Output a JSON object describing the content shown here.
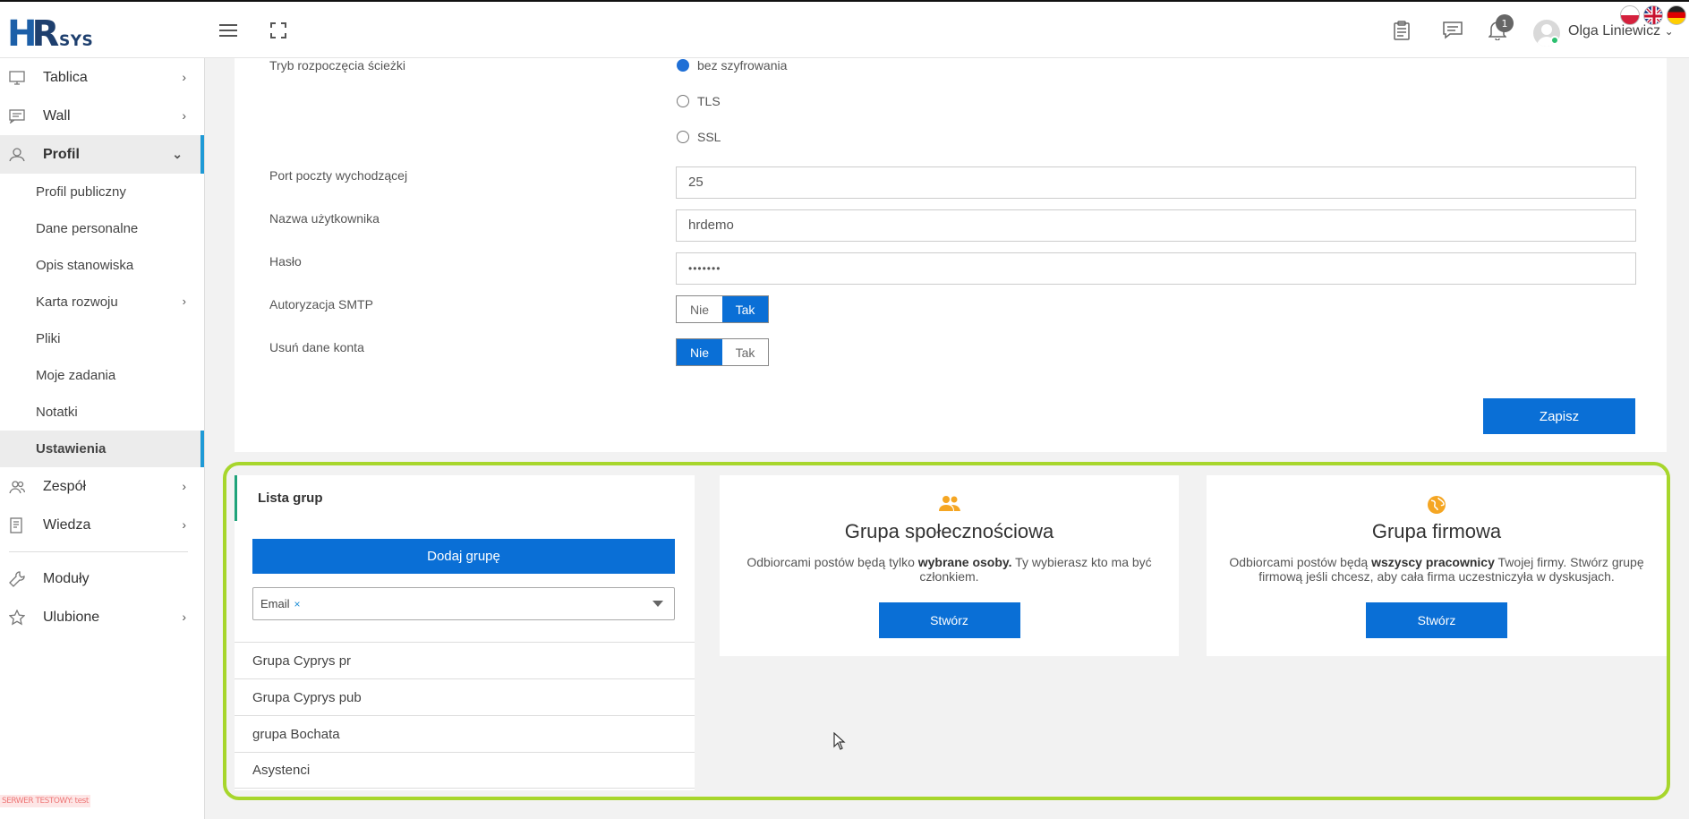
{
  "brand": {
    "logo_text_h": "H",
    "logo_text_r": "R",
    "logo_sys": "SYS"
  },
  "topbar": {
    "notification_count": "1",
    "user_name": "Olga Liniewicz",
    "user_chevron": "⌄",
    "icons": [
      "menu-icon",
      "fullscreen-icon",
      "clipboard-icon",
      "chat-icon",
      "bell-icon"
    ],
    "languages": [
      "pl-flag",
      "en-flag",
      "de-flag"
    ]
  },
  "sidebar": {
    "items": [
      {
        "label": "Tablica",
        "icon": "dashboard-icon",
        "chevron": "›"
      },
      {
        "label": "Wall",
        "icon": "wall-icon",
        "chevron": "›"
      },
      {
        "label": "Profil",
        "icon": "user-icon",
        "chevron": "⌄"
      }
    ],
    "profile_sub": [
      {
        "label": "Profil publiczny"
      },
      {
        "label": "Dane personalne"
      },
      {
        "label": "Opis stanowiska"
      },
      {
        "label": "Karta rozwoju",
        "chevron": "›"
      },
      {
        "label": "Pliki"
      },
      {
        "label": "Moje zadania"
      },
      {
        "label": "Notatki"
      },
      {
        "label": "Ustawienia"
      }
    ],
    "items_after": [
      {
        "label": "Zespół",
        "icon": "team-icon",
        "chevron": "›"
      },
      {
        "label": "Wiedza",
        "icon": "book-icon",
        "chevron": "›"
      }
    ],
    "items_bottom": [
      {
        "label": "Moduły",
        "icon": "wrench-icon"
      },
      {
        "label": "Ulubione",
        "icon": "star-icon",
        "chevron": "›"
      }
    ],
    "test_server": "SERWER TESTOWY: test"
  },
  "form": {
    "start_mode_label": "Tryb rozpoczęcia ścieżki",
    "radio_options": [
      "bez szyfrowania",
      "TLS",
      "SSL"
    ],
    "port_label": "Port poczty wychodzącej",
    "port_value": "25",
    "username_label": "Nazwa użytkownika",
    "username_value": "hrdemo",
    "password_label": "Hasło",
    "password_value": "•••••••",
    "smtp_auth_label": "Autoryzacja SMTP",
    "delete_label": "Usuń dane konta",
    "no": "Nie",
    "yes": "Tak",
    "save": "Zapisz"
  },
  "groups": {
    "list_title": "Lista grup",
    "add_button": "Dodaj grupę",
    "filter_value": "Email",
    "filter_remove": "×",
    "items": [
      "Grupa Cyprys pr",
      "Grupa Cyprys pub",
      "grupa Bochata",
      "Asystenci"
    ],
    "social": {
      "title": "Grupa społecznościowa",
      "desc_pre": "Odbiorcami postów będą tylko ",
      "desc_bold": "wybrane osoby.",
      "desc_post": " Ty wybierasz kto ma być członkiem.",
      "button": "Stwórz",
      "color": "#f5a623"
    },
    "company": {
      "title": "Grupa firmowa",
      "desc_pre": "Odbiorcami postów będą ",
      "desc_bold": "wszyscy pracownicy",
      "desc_post": " Twojej firmy. Stwórz grupę firmową jeśli chcesz, aby cała firma uczestniczyła w dyskusjach.",
      "button": "Stwórz",
      "color": "#f5a623"
    }
  },
  "colors": {
    "primary": "#0a6fd6",
    "highlight": "#a7d62c",
    "active_bar": "#1f9ad6"
  }
}
